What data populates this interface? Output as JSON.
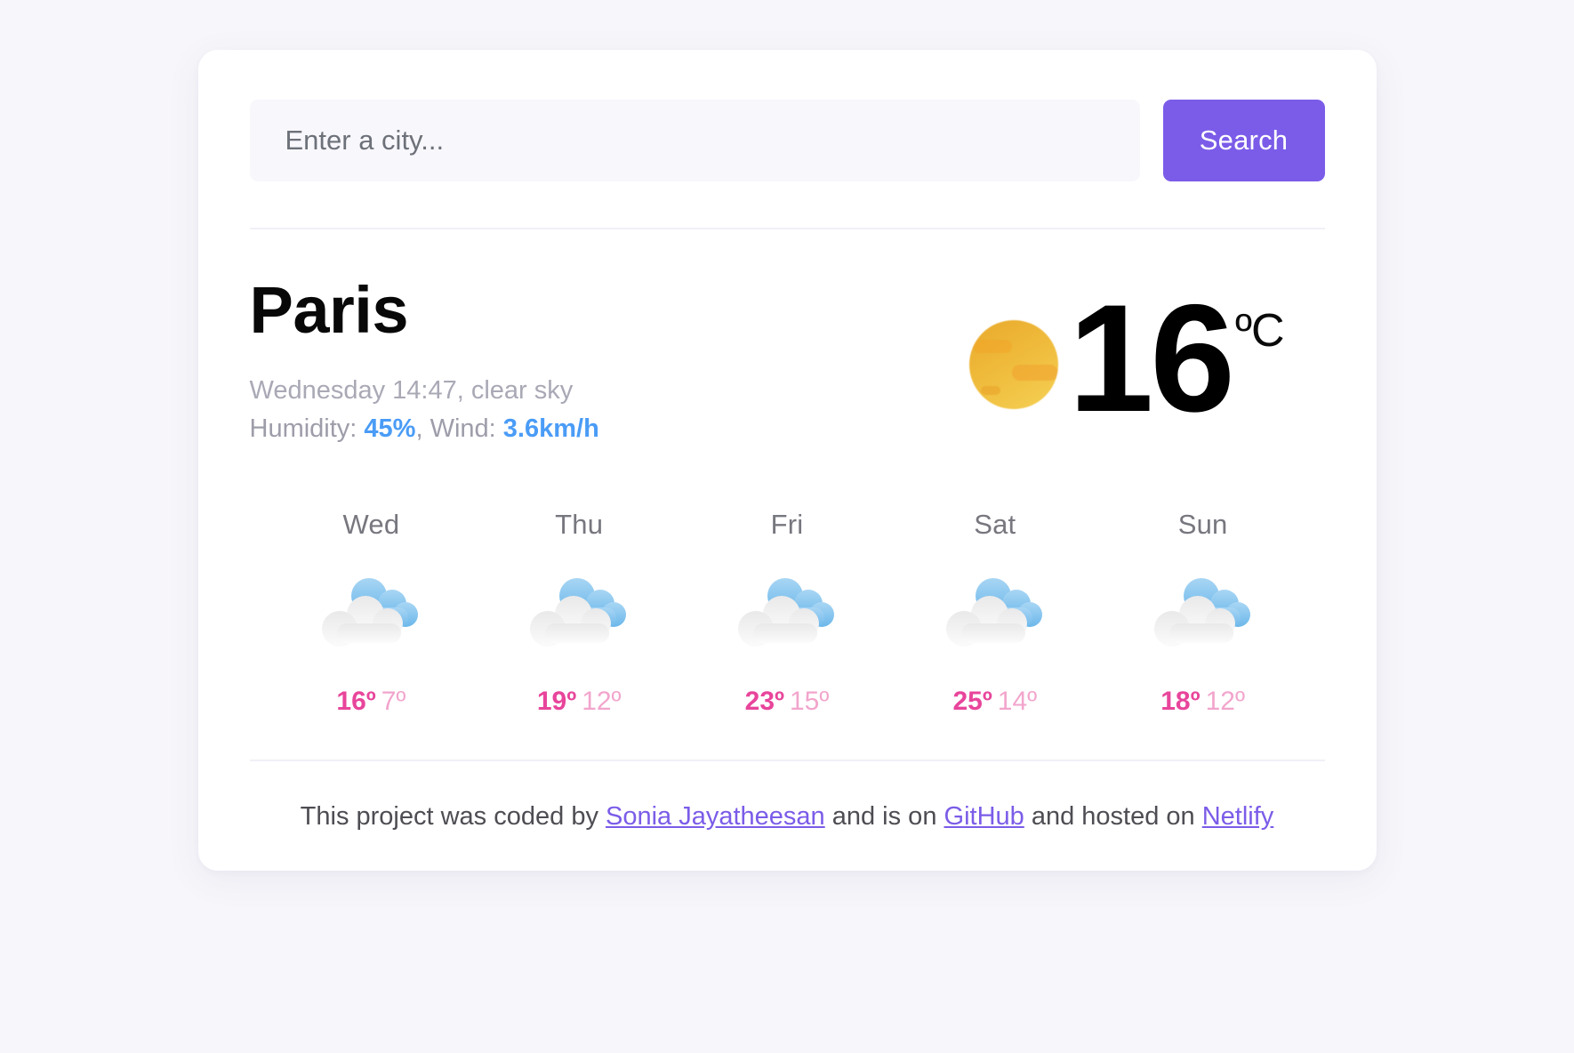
{
  "search": {
    "placeholder": "Enter a city...",
    "value": "",
    "button_label": "Search"
  },
  "current": {
    "city": "Paris",
    "datetime_description": "Wednesday 14:47, clear sky",
    "humidity_label": "Humidity: ",
    "humidity_value": "45%",
    "wind_separator": ", Wind: ",
    "wind_value": "3.6km/h",
    "temperature": "16",
    "unit": "ºC",
    "icon": "sun-icon"
  },
  "forecast": [
    {
      "day": "Wed",
      "icon": "partly-cloudy-icon",
      "max": "16º",
      "min": "7º"
    },
    {
      "day": "Thu",
      "icon": "partly-cloudy-icon",
      "max": "19º",
      "min": "12º"
    },
    {
      "day": "Fri",
      "icon": "partly-cloudy-icon",
      "max": "23º",
      "min": "15º"
    },
    {
      "day": "Sat",
      "icon": "partly-cloudy-icon",
      "max": "25º",
      "min": "14º"
    },
    {
      "day": "Sun",
      "icon": "partly-cloudy-icon",
      "max": "18º",
      "min": "12º"
    }
  ],
  "footer": {
    "text_1": "This project was coded by ",
    "link_author": "Sonia Jayatheesan",
    "text_2": " and is on ",
    "link_github": "GitHub",
    "text_3": " and hosted on ",
    "link_netlify": "Netlify"
  },
  "colors": {
    "accent_purple": "#7b5ce8",
    "metric_blue": "#4a9cf6",
    "temp_max_pink": "#e8459b",
    "temp_min_pink": "#f2a5cc",
    "page_bg": "#f7f6fa",
    "card_bg": "#ffffff"
  }
}
